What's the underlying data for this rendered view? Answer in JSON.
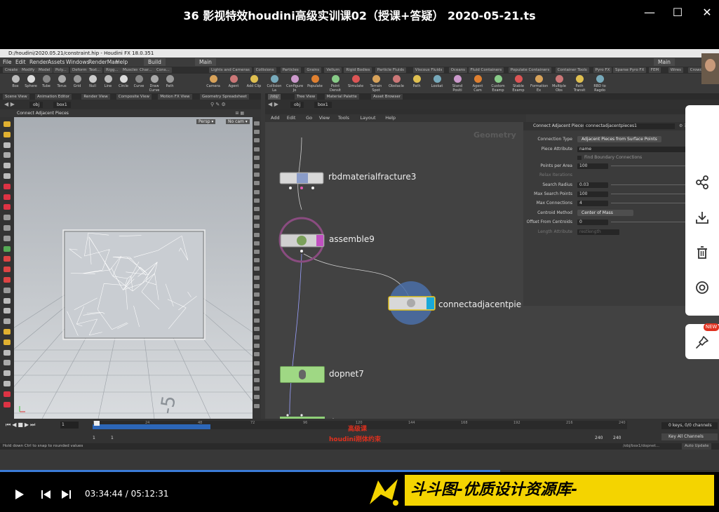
{
  "player": {
    "title": "36 影视特效houdini高级实训课02（授课+答疑） 2020-05-21.ts",
    "window_controls": [
      "—",
      "☐",
      "✕"
    ],
    "current_time": "03:34:44",
    "duration": "05:12:31",
    "time_display": "03:34:44 / 05:12:31",
    "progress_fraction": 0.6959,
    "watermark_text": "斗斗图-优质设计资源库-www.ddotu.com"
  },
  "houdini": {
    "window_title": "D:/houdini/2020.05.21/constraint.hip - Houdini FX 18.0.351",
    "menu": [
      "File",
      "Edit",
      "Render",
      "Assets",
      "Windows",
      "RenderMan",
      "Help"
    ],
    "build_label": "Build",
    "desktop_label": "Main",
    "shelf_tabs_left": [
      "Create",
      "Modify",
      "Model",
      "Poly...",
      "Deform",
      "Text...",
      "Rigg...",
      "Muscles",
      "Char...",
      "Cons..."
    ],
    "shelf_tabs_right": [
      "Lights and Cameras",
      "Collisions",
      "Particles",
      "Grains",
      "Vellum",
      "Rigid Bodies",
      "Particle Fluids",
      "Viscous Fluids",
      "Oceans",
      "Fluid Containers",
      "Populate Containers",
      "Container Tools",
      "Pyro FX",
      "Sparse Pyro FX",
      "FEM",
      "Wires",
      "Crowds",
      "Drive Simulation"
    ],
    "tools_left": [
      "Box",
      "Sphere",
      "Tube",
      "Torus",
      "Grid",
      "Null",
      "Line",
      "Circle",
      "Curve",
      "Draw Curve",
      "Path"
    ],
    "tools_right": [
      "Camera",
      "Agent",
      "Add Clip",
      "Collision Layer",
      "Configure Joints",
      "Populate",
      "Point Density",
      "Simulate",
      "Terrain Spot Painting",
      "Obstacle",
      "Path",
      "Lookat",
      "Stand Position",
      "Agent Cam",
      "Custom Example",
      "Stable Example",
      "Formation Example",
      "Multiple Obstacles E...",
      "Path Transition...",
      "RBD to Ragdoll Example"
    ],
    "pane_tabs_left": [
      "Scene View",
      "Animation Editor",
      "Render View",
      "Composite View",
      "Motion FX View",
      "Geometry Spreadsheet"
    ],
    "pane_tabs_right": [
      "Tree View",
      "Material Palette",
      "Asset Browser"
    ],
    "left_path": [
      "obj",
      "box1"
    ],
    "right_path": [
      "obj",
      "box1"
    ],
    "viewport_title": "Connect Adjacent Pieces",
    "viewport_persp": "Persp ▾",
    "viewport_cam": "No cam ▾",
    "viewport_grid_number": "-5",
    "network_menu": [
      "Add",
      "Edit",
      "Go",
      "View",
      "Tools",
      "Layout",
      "Help"
    ],
    "network_context_label": "Geometry",
    "nodes": {
      "n1": "rbdmaterialfracture3",
      "n2": "assemble9",
      "n3": "connectadjacentpie",
      "n4": "dopnet7"
    },
    "params": {
      "node_type": "Connect Adjacent Pieces",
      "node_name": "connectadjacentpieces1",
      "connection_type_label": "Connection Type",
      "connection_type_value": "Adjacent Pieces from Surface Points",
      "piece_attr_label": "Piece Attribute",
      "piece_attr_value": "name",
      "find_boundary_label": "Find Boundary Connections",
      "points_per_area_label": "Points per Area",
      "points_per_area_value": "100",
      "relax_label": "Relax Iterations",
      "search_radius_label": "Search Radius",
      "search_radius_value": "0.03",
      "max_search_label": "Max Search Points",
      "max_search_value": "100",
      "max_conn_label": "Max Connections",
      "max_conn_value": "4",
      "centroid_label": "Centroid Method",
      "centroid_value": "Center of Mass",
      "offset_label": "Offset From Centroids",
      "offset_value": "0",
      "length_label": "Length Attribute",
      "length_value": "restlength"
    },
    "timeline": {
      "frame": "1",
      "ticks": [
        "1",
        "24",
        "48",
        "72",
        "96",
        "120",
        "144",
        "168",
        "192",
        "216",
        "240"
      ],
      "start": "1",
      "start2": "1",
      "end": "240",
      "end2": "240",
      "keys_label": "0 keys, 0/0 channels",
      "key_all_label": "Key All Channels",
      "auto_update": "Auto Update",
      "path_label": "/obj/box1/dopnet..."
    },
    "status_text": "Hold down Ctrl to snap to rounded values",
    "overlay_line1": "高级课",
    "overlay_line2": "houdini刚体约束"
  },
  "side_panel": {
    "items": [
      "share-icon",
      "download-icon",
      "trash-icon",
      "view-icon"
    ],
    "badge": "NEW"
  }
}
